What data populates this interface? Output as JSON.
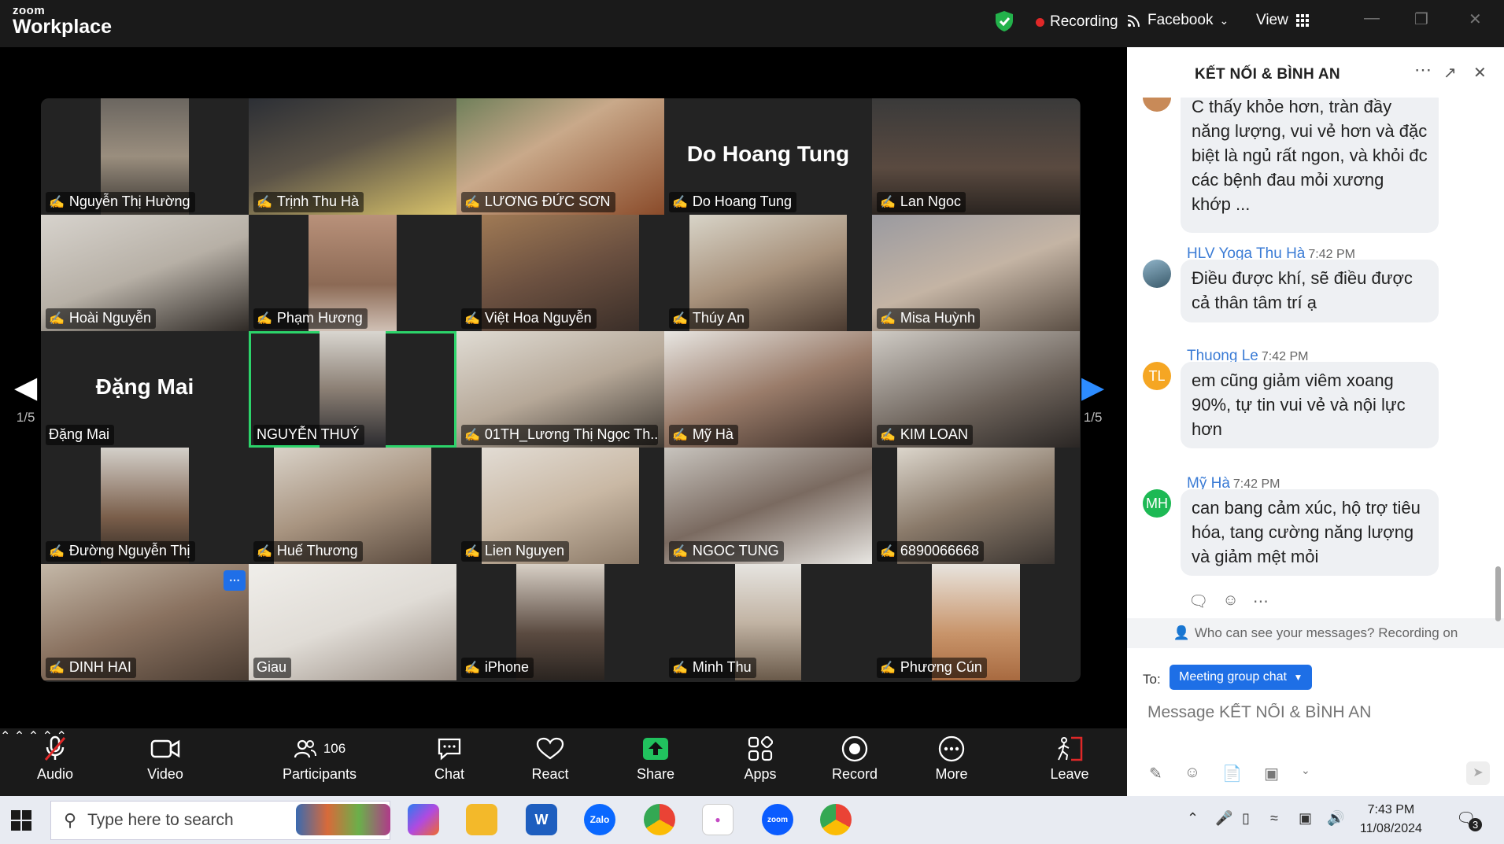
{
  "topbar": {
    "logo_small": "zoom",
    "logo_big": "Workplace",
    "recording": "Recording",
    "facebook": "Facebook",
    "view": "View"
  },
  "gallery": {
    "page_left": "1/5",
    "page_right": "1/5",
    "tiles": [
      {
        "name": "Nguyễn Thị Hường"
      },
      {
        "name": "Trịnh Thu Hà"
      },
      {
        "name": "LƯƠNG ĐỨC SƠN"
      },
      {
        "name": "Do Hoang Tung",
        "big": "Do Hoang Tung"
      },
      {
        "name": "Lan Ngoc"
      },
      {
        "name": "Hoài Nguyễn"
      },
      {
        "name": "Phạm Hương"
      },
      {
        "name": "Việt Hoa Nguyễn"
      },
      {
        "name": "Thúy An"
      },
      {
        "name": "Misa Huỳnh"
      },
      {
        "name": "Đặng Mai",
        "big": "Đặng Mai"
      },
      {
        "name": "NGUYỄN THUÝ"
      },
      {
        "name": "01TH_Lương Thị Ngọc Th..."
      },
      {
        "name": "Mỹ Hà"
      },
      {
        "name": "KIM LOAN"
      },
      {
        "name": "Đường Nguyễn Thị"
      },
      {
        "name": "Huế Thương"
      },
      {
        "name": "Lien Nguyen"
      },
      {
        "name": "NGOC TUNG"
      },
      {
        "name": "6890066668"
      },
      {
        "name": "DINH HAI"
      },
      {
        "name": "Giau"
      },
      {
        "name": "iPhone"
      },
      {
        "name": "Minh Thu"
      },
      {
        "name": "Phương Cún"
      }
    ]
  },
  "toolbar": {
    "audio": "Audio",
    "video": "Video",
    "participants": "Participants",
    "participants_count": "106",
    "chat": "Chat",
    "react": "React",
    "share": "Share",
    "apps": "Apps",
    "record": "Record",
    "more": "More",
    "leave": "Leave"
  },
  "chat": {
    "title": "KẾT NỐI & BÌNH AN",
    "messages": [
      {
        "text": "C thấy khỏe hơn, tràn đầy năng lượng, vui vẻ hơn và đặc biệt là ngủ rất ngon, và khỏi đc các bệnh đau mỏi xương khớp ..."
      },
      {
        "sender": "HLV Yoga Thu Hà",
        "time": "7:42 PM",
        "text": "Điều được khí, sẽ điều được cả thân tâm trí ạ"
      },
      {
        "sender": "Thuong Le",
        "time": "7:42 PM",
        "initials": "TL",
        "text": "em cũng giảm viêm xoang 90%, tự tin vui vẻ và nội lực hơn"
      },
      {
        "sender": "Mỹ Hà",
        "time": "7:42 PM",
        "initials": "MH",
        "text": "can bang cảm xúc, hộ trợ tiêu hóa, tang cường năng lượng và giảm mệt mỏi"
      }
    ],
    "privacy": "Who can see your messages? Recording on",
    "to_label": "To:",
    "to_value": "Meeting group chat",
    "input_placeholder": "Message KẾT NỐI & BÌNH AN",
    "colors": {
      "tl": "#f5a623",
      "mh": "#1db954",
      "accent": "#1e6fe6"
    }
  },
  "taskbar": {
    "search_placeholder": "Type here to search",
    "time": "7:43 PM",
    "date": "11/08/2024",
    "notif_count": "3"
  }
}
